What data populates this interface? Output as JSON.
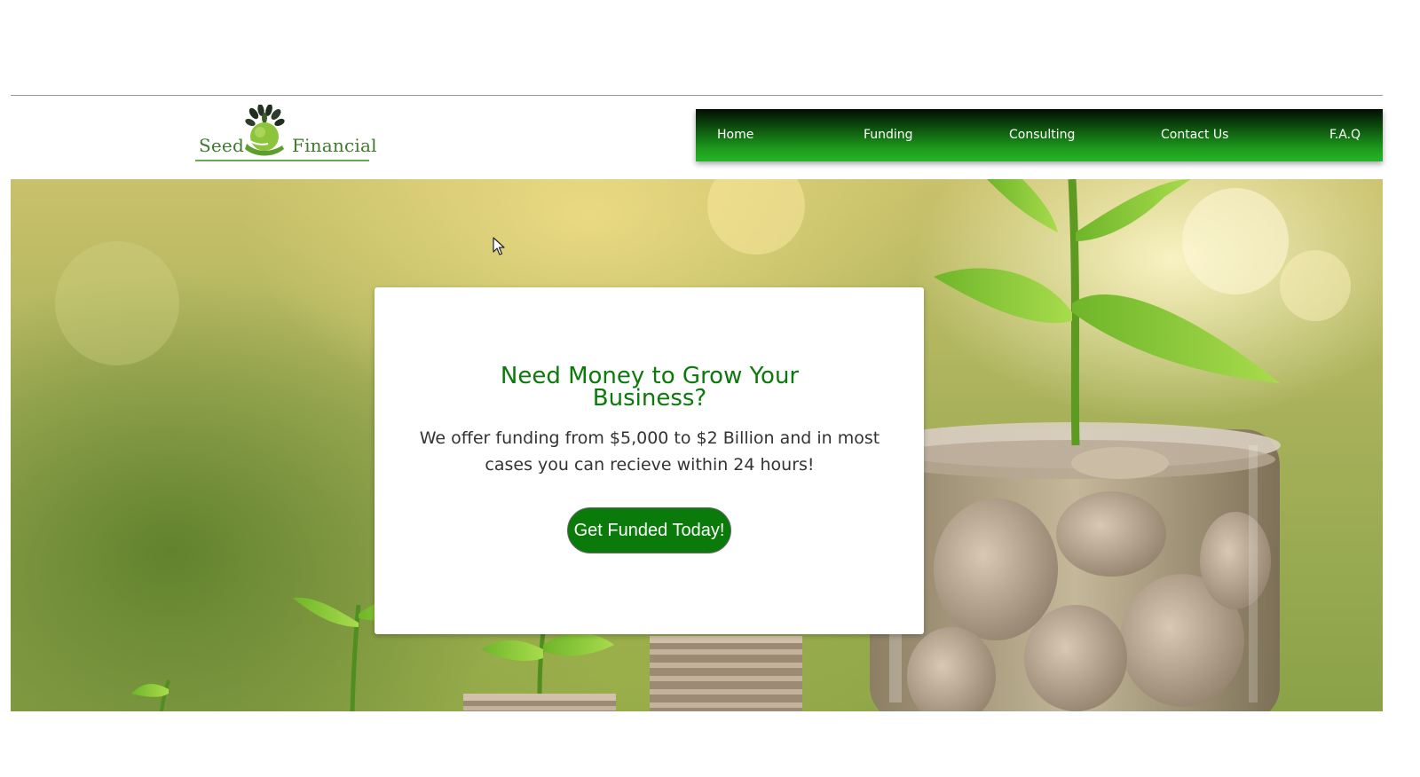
{
  "logo": {
    "word_left": "Seed",
    "word_right": "Financial",
    "icon": "leaf-hand-icon"
  },
  "nav": {
    "items": [
      {
        "label": "Home"
      },
      {
        "label": "Funding"
      },
      {
        "label": "Consulting"
      },
      {
        "label": "Contact Us"
      },
      {
        "label": "F.A.Q"
      }
    ]
  },
  "hero": {
    "image": "coins-and-plants-photo",
    "card": {
      "title": "Need Money to Grow Your Business?",
      "text": "We offer funding from $5,000 to $2 Billion and in most cases you can recieve within 24 hours!",
      "cta_label": "Get Funded Today!"
    }
  },
  "colors": {
    "brand_green": "#0a7a0a",
    "nav_dark": "#020e02",
    "nav_light": "#28b428"
  }
}
